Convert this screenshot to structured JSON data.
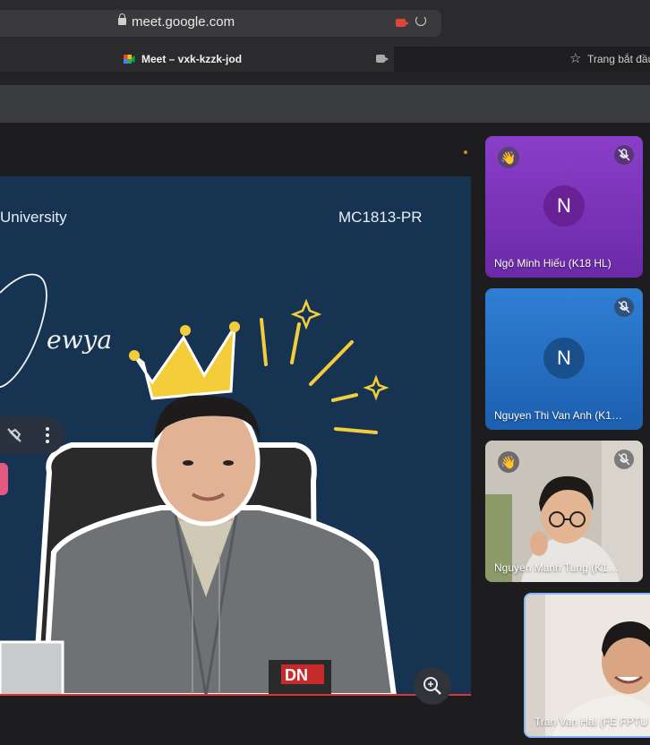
{
  "browser": {
    "url": "meet.google.com",
    "tab_active": "Meet – vxk-kzzk-jod",
    "tab_other": "Trang bắt đầu"
  },
  "slide": {
    "left_text": "University",
    "right_text": "MC1813-PR",
    "script_text": "ewya",
    "badge_text": "DN"
  },
  "participants": [
    {
      "name": "Ngô Minh Hiếu (K18 HL)",
      "avatar_letter": "N",
      "muted": true,
      "hand_raised": true,
      "tile_color": "#7d35bd"
    },
    {
      "name": "Nguyen Thi Van Anh (K1…",
      "avatar_letter": "N",
      "muted": true,
      "hand_raised": false,
      "tile_color": "#2a74c9"
    },
    {
      "name": "Nguyen Manh Tung (K1…",
      "avatar_letter": "",
      "muted": true,
      "hand_raised": true,
      "tile_color": "#bfb9ae"
    },
    {
      "name": "Tran Van Hai (FE FPTU H…",
      "avatar_letter": "",
      "muted": false,
      "hand_raised": false,
      "tile_color": "#e8e4de"
    }
  ],
  "icons": {
    "wave": "👋"
  }
}
